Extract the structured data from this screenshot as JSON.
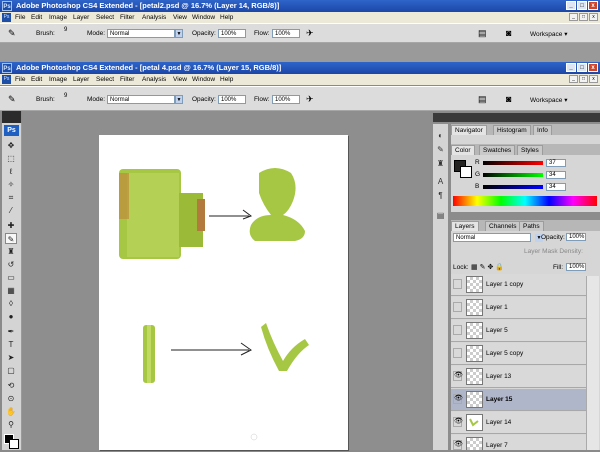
{
  "window_back": {
    "title": "Adobe Photoshop CS4 Extended - [petal2.psd @ 16.7% (Layer 14, RGB/8)]",
    "menu": [
      "File",
      "Edit",
      "Image",
      "Layer",
      "Select",
      "Filter",
      "Analysis",
      "View",
      "Window",
      "Help"
    ],
    "options": {
      "brush_label": "Brush:",
      "brush_size": "9",
      "mode_label": "Mode:",
      "mode_value": "Normal",
      "opacity_label": "Opacity:",
      "opacity_value": "100%",
      "flow_label": "Flow:",
      "flow_value": "100%",
      "workspace": "Workspace ▾"
    }
  },
  "window_front": {
    "title": "Adobe Photoshop CS4 Extended - [petal 4.psd @ 16.7% (Layer 15, RGB/8)]",
    "menu": [
      "File",
      "Edit",
      "Image",
      "Layer",
      "Select",
      "Filter",
      "Analysis",
      "View",
      "Window",
      "Help"
    ],
    "options": {
      "brush_label": "Brush:",
      "brush_size": "9",
      "mode_label": "Mode:",
      "mode_value": "Normal",
      "opacity_label": "Opacity:",
      "opacity_value": "100%",
      "flow_label": "Flow:",
      "flow_value": "100%",
      "workspace": "Workspace ▾"
    }
  },
  "toolbox": {
    "logo": "Ps"
  },
  "navigator_tabs": [
    "Navigator",
    "Histogram",
    "Info"
  ],
  "color_tabs": [
    "Color",
    "Swatches",
    "Styles"
  ],
  "color": {
    "r_label": "R",
    "g_label": "G",
    "b_label": "B",
    "r": "37",
    "g": "34",
    "b": "34"
  },
  "layers_tabs": [
    "Layers",
    "Channels",
    "Paths"
  ],
  "layers": {
    "blend_mode": "Normal",
    "opacity_label": "Opacity:",
    "opacity": "100%",
    "mask_density": "Layer Mask Density:",
    "lock_label": "Lock:",
    "fill_label": "Fill:",
    "fill": "100%",
    "rows": [
      {
        "name": "Layer 1 copy",
        "visible": false,
        "selected": false
      },
      {
        "name": "Layer 1",
        "visible": false,
        "selected": false
      },
      {
        "name": "Layer 5",
        "visible": false,
        "selected": false
      },
      {
        "name": "Layer 5 copy",
        "visible": false,
        "selected": false
      },
      {
        "name": "Layer 13",
        "visible": true,
        "selected": false
      },
      {
        "name": "Layer 15",
        "visible": true,
        "selected": true
      },
      {
        "name": "Layer 14",
        "visible": true,
        "selected": false
      },
      {
        "name": "Layer 7",
        "visible": true,
        "selected": false
      }
    ]
  },
  "colors": {
    "accent": "#2f64c9",
    "leaf_green": "#a8c843",
    "selected_layer": "#b0b6c9"
  }
}
